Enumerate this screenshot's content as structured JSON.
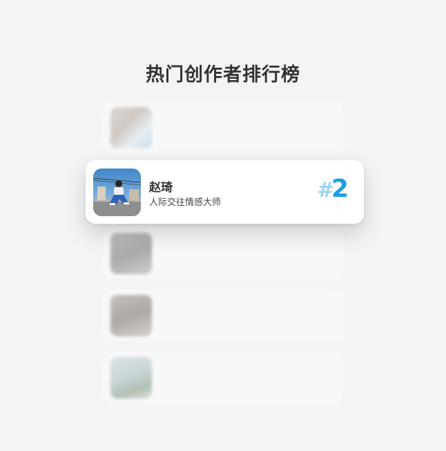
{
  "page": {
    "title": "热门创作者排行榜"
  },
  "focused_creator": {
    "name": "赵琦",
    "description": "人际交往情感大师",
    "rank_hash": "#",
    "rank_number": "2"
  },
  "blurred_creators": [
    {
      "name": "",
      "description": ""
    },
    {
      "name": "",
      "description": ""
    },
    {
      "name": "",
      "description": ""
    },
    {
      "name": "",
      "description": ""
    }
  ],
  "colors": {
    "background": "#f4f4f4",
    "rank_accent": "#1aa0e8",
    "rank_hash": "#9fd3f3",
    "title": "#333333"
  }
}
